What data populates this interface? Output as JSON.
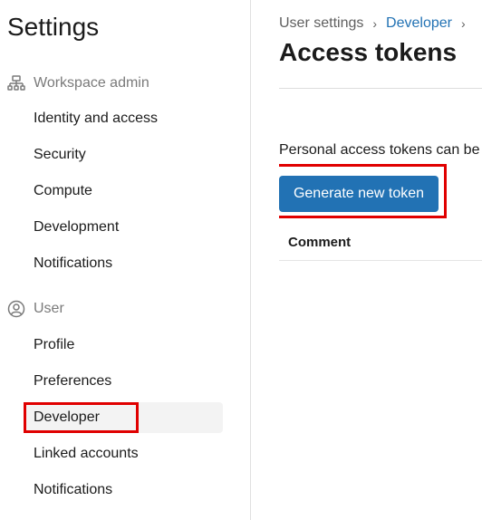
{
  "sidebar": {
    "title": "Settings",
    "workspace_section": {
      "label": "Workspace admin",
      "icon": "workspace-admin-icon",
      "items": [
        "Identity and access",
        "Security",
        "Compute",
        "Development",
        "Notifications"
      ]
    },
    "user_section": {
      "label": "User",
      "icon": "user-circle-icon",
      "items": [
        "Profile",
        "Preferences",
        "Developer",
        "Linked accounts",
        "Notifications"
      ],
      "active_item": "Developer"
    }
  },
  "main": {
    "breadcrumb": [
      "User settings",
      "Developer"
    ],
    "title": "Access tokens",
    "description": "Personal access tokens can be u",
    "generate_button_label": "Generate new token",
    "table": {
      "columns": [
        "Comment"
      ]
    }
  },
  "colors": {
    "accent": "#2272b4",
    "highlight": "#e00000",
    "active_bg": "#f3f3f3",
    "muted_text": "#7a7a7a"
  }
}
